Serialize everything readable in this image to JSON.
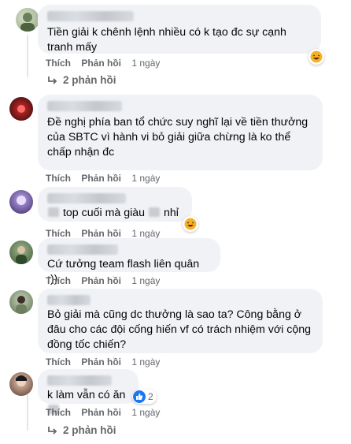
{
  "comments": [
    {
      "text": "Tiền giải k chênh lệnh nhiều có k tạo đc sự cạnh tranh mấy",
      "like": "Thích",
      "reply": "Phản hồi",
      "time": "1 ngày",
      "reaction": "haha-icon",
      "replies_label": "2 phản hồi"
    },
    {
      "text": "Đề nghị phía ban tổ chức suy nghĩ lại về tiền thưởng của SBTC vì hành vi bỏ giải giữa chừng là ko thể chấp nhận đc",
      "like": "Thích",
      "reply": "Phản hồi",
      "time": "1 ngày"
    },
    {
      "text_a": "top cuối mà giàu",
      "text_b": "nhỉ",
      "like": "Thích",
      "reply": "Phản hồi",
      "time": "1 ngày",
      "reaction": "haha-icon"
    },
    {
      "text": "Cứ tưởng team flash liên quân :))",
      "like": "Thích",
      "reply": "Phản hồi",
      "time": "1 ngày"
    },
    {
      "text": "Bỏ giải mà cũng dc thưởng là sao ta? Công bằng ở đâu cho các đội cống hiến vf có trách nhiệm với cộng đồng tốc chiến?",
      "like": "Thích",
      "reply": "Phản hồi",
      "time": "1 ngày"
    },
    {
      "text": "k làm vẫn có ăn",
      "like": "Thích",
      "reply": "Phản hồi",
      "time": "1 ngày",
      "reaction": "like-icon",
      "reaction_count": "2",
      "replies_label": "2 phản hồi"
    }
  ],
  "colors": {
    "bubble": "#f0f2f5",
    "meta": "#65676b",
    "like_blue": "#1877f2",
    "haha_yellow": "#f7b125"
  }
}
